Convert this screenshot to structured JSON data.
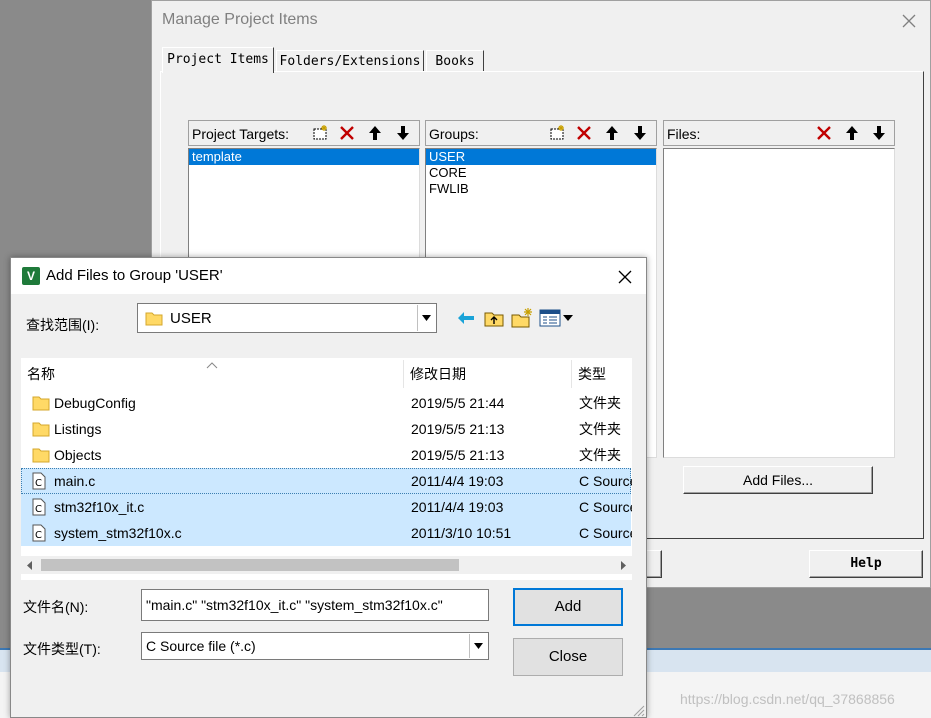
{
  "manage": {
    "title": "Manage Project Items",
    "tabs": [
      "Project Items",
      "Folders/Extensions",
      "Books"
    ],
    "targets": {
      "label": "Project Targets:",
      "items": [
        "template"
      ]
    },
    "groups": {
      "label": "Groups:",
      "items": [
        "USER",
        "CORE",
        "FWLIB"
      ]
    },
    "files": {
      "label": "Files:",
      "items": []
    },
    "add_files_button": "Add Files...",
    "help_button": "Help"
  },
  "add_dialog": {
    "title": "Add Files to Group 'USER'",
    "look_in_label": "查找范围(I):",
    "look_in_value": "USER",
    "columns": [
      "名称",
      "修改日期",
      "类型"
    ],
    "rows": [
      {
        "icon": "folder-icon",
        "name": "DebugConfig",
        "date": "2019/5/5 21:44",
        "type": "文件夹",
        "selected": false
      },
      {
        "icon": "folder-icon",
        "name": "Listings",
        "date": "2019/5/5 21:13",
        "type": "文件夹",
        "selected": false
      },
      {
        "icon": "folder-icon",
        "name": "Objects",
        "date": "2019/5/5 21:13",
        "type": "文件夹",
        "selected": false
      },
      {
        "icon": "c-file-icon",
        "name": "main.c",
        "date": "2011/4/4 19:03",
        "type": "C Source",
        "selected": true
      },
      {
        "icon": "c-file-icon",
        "name": "stm32f10x_it.c",
        "date": "2011/4/4 19:03",
        "type": "C Source",
        "selected": true
      },
      {
        "icon": "c-file-icon",
        "name": "system_stm32f10x.c",
        "date": "2011/3/10 10:51",
        "type": "C Source",
        "selected": true
      }
    ],
    "filename_label": "文件名(N):",
    "filename_value": "\"main.c\" \"stm32f10x_it.c\" \"system_stm32f10x.c\"",
    "filetype_label": "文件类型(T):",
    "filetype_value": "C Source file (*.c)",
    "add_button": "Add",
    "close_button": "Close"
  },
  "watermark": "https://blog.csdn.net/qq_37868856"
}
